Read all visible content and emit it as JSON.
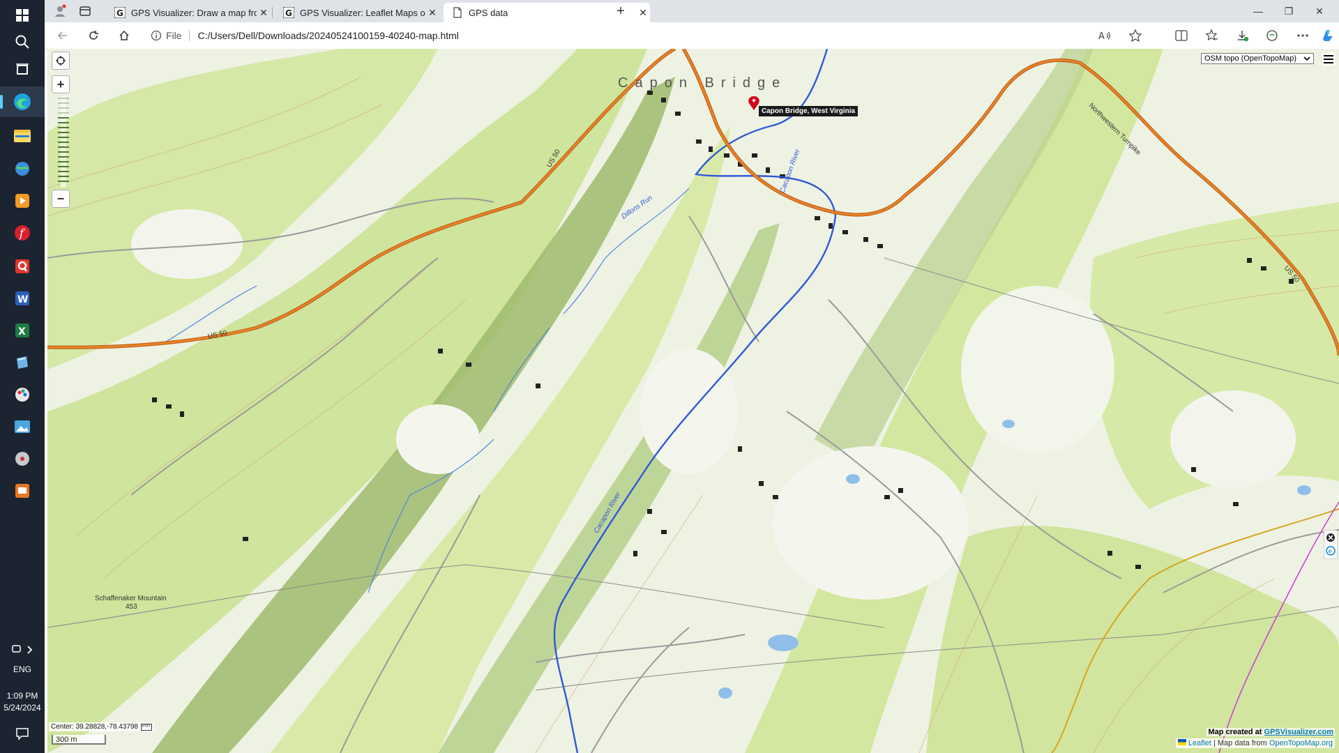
{
  "taskbar": {
    "lang": "ENG",
    "time": "1:09 PM",
    "date": "5/24/2024"
  },
  "tabs": [
    {
      "title": "GPS Visualizer: Draw a map from",
      "close": "✕"
    },
    {
      "title": "GPS Visualizer: Leaflet Maps outp",
      "close": "✕"
    },
    {
      "title": "GPS data",
      "close": "✕"
    }
  ],
  "new_tab": "+",
  "window_controls": {
    "minimize": "—",
    "restore": "❐",
    "close": "✕"
  },
  "address": {
    "scheme_label": "File",
    "url": "C:/Users/Dell/Downloads/20240524100159-40240-map.html"
  },
  "map": {
    "zoom_in": "+",
    "zoom_out": "−",
    "layer": "OSM topo (OpenTopoMap)",
    "marker_tooltip": "Capon Bridge, West Virginia",
    "town_label": "Capon Bridge",
    "center_readout": "Center: 39.28828,-78.43798",
    "scale": "300 m",
    "credit_line1_prefix": "Map created at",
    "credit_line1_link": "GPSVisualizer.com",
    "credit_line2_link1": "Leaflet",
    "credit_line2_mid": "| Map data from",
    "credit_line2_link2": "OpenTopoMap.org",
    "labels": {
      "us50_a": "US 50",
      "us50_b": "US 50",
      "us50_c": "US 50",
      "river1": "Cacapon River",
      "river2": "Cacapon River",
      "dillons": "Dillons Run",
      "turnpike": "Northwestern Turnpike",
      "mountain": "Schaffenaker Mountain",
      "elev": "453"
    }
  },
  "colors": {
    "terrain_light": "#eef2e3",
    "terrain_green": "#cfe5a0",
    "terrain_dark": "#a8c77a",
    "road_orange": "#e8822a",
    "river_blue": "#2f58d8",
    "marker_red": "#d6001c"
  }
}
